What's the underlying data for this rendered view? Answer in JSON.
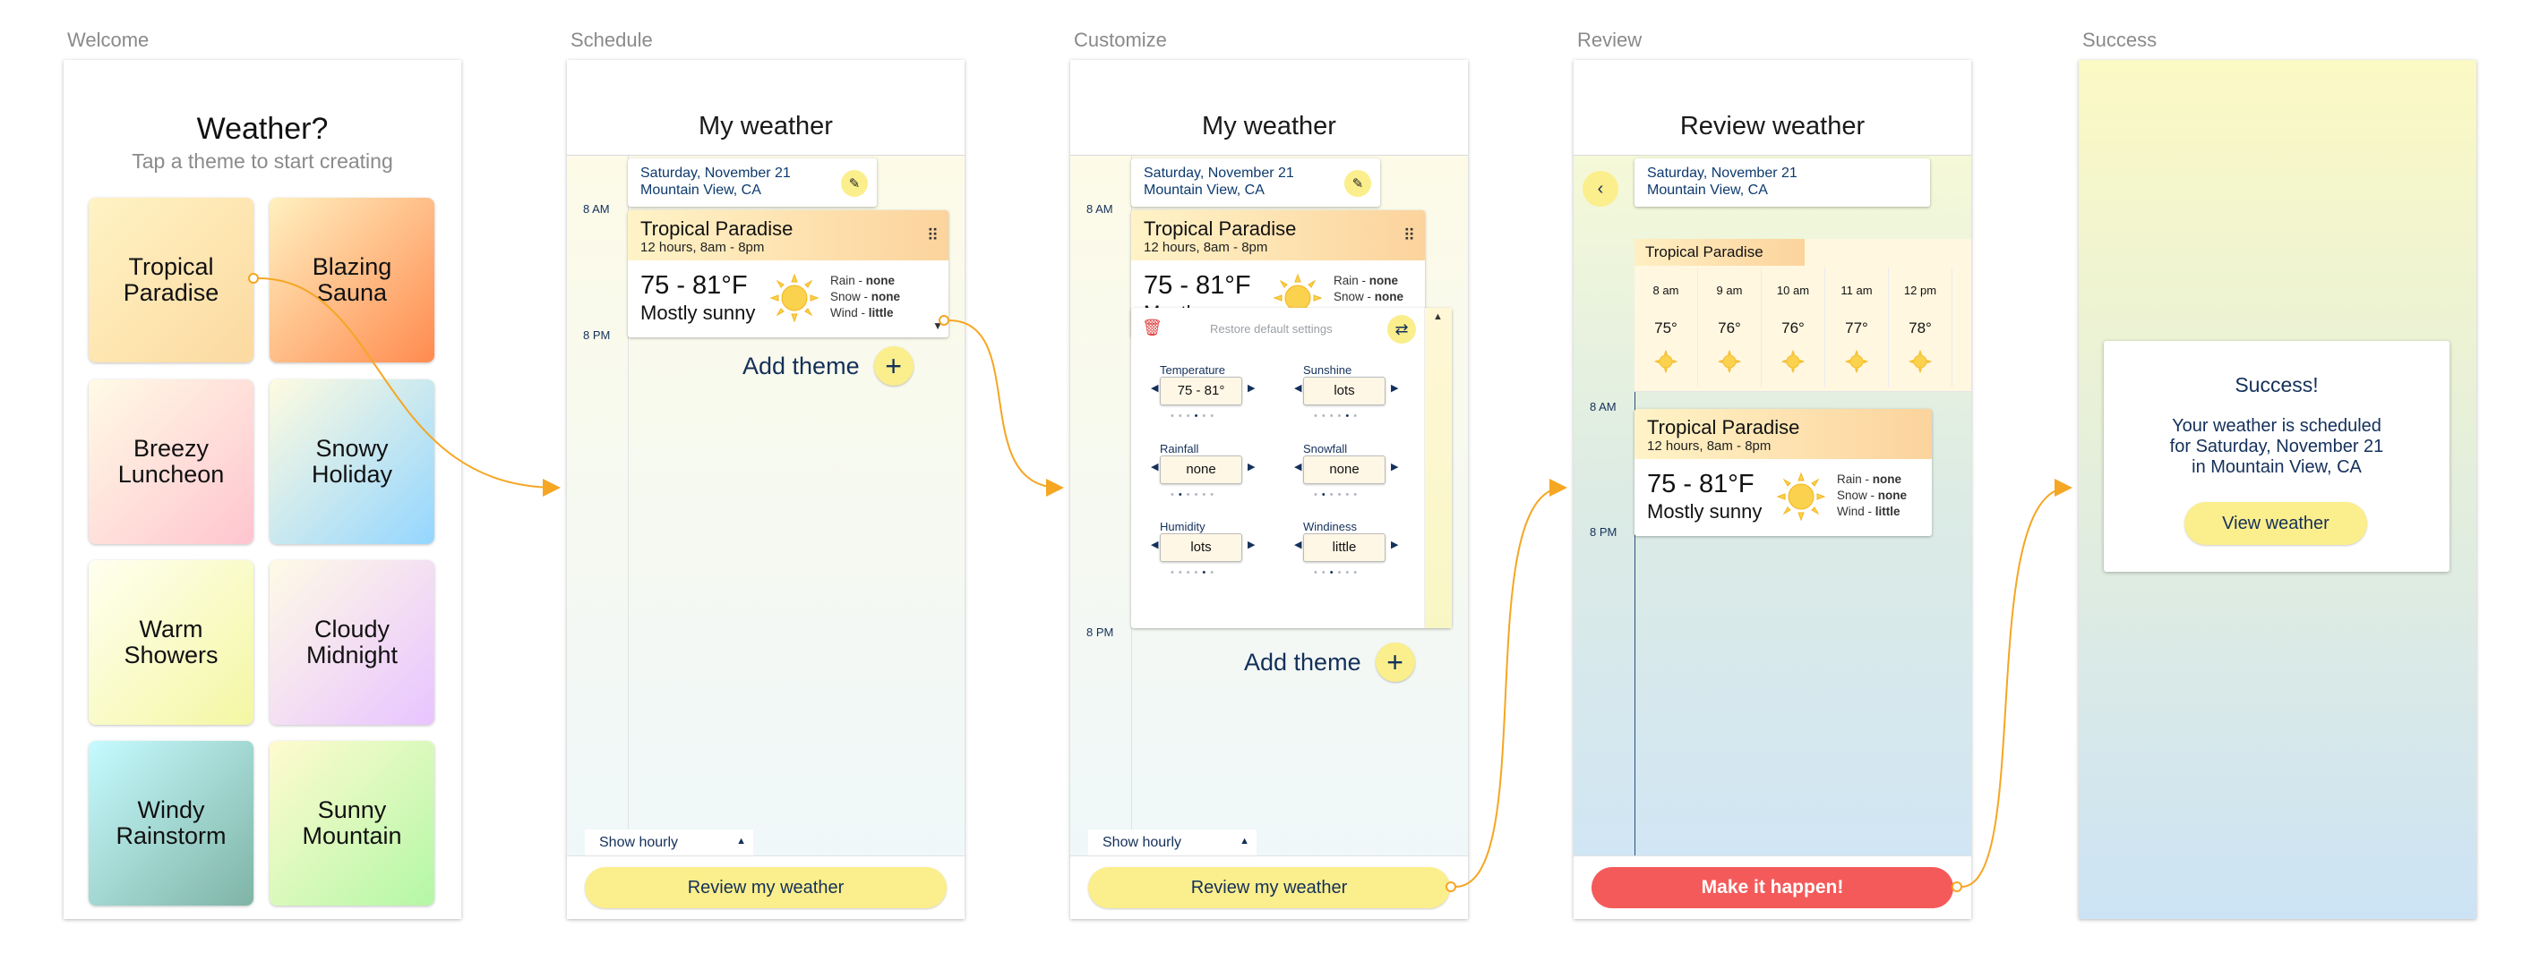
{
  "steps": [
    "Welcome",
    "Schedule",
    "Customize",
    "Review",
    "Success"
  ],
  "welcome": {
    "title": "Weather?",
    "subtitle": "Tap a theme to start creating",
    "themes": [
      {
        "line1": "Tropical",
        "line2": "Paradise"
      },
      {
        "line1": "Blazing",
        "line2": "Sauna"
      },
      {
        "line1": "Breezy",
        "line2": "Luncheon"
      },
      {
        "line1": "Snowy",
        "line2": "Holiday"
      },
      {
        "line1": "Warm",
        "line2": "Showers"
      },
      {
        "line1": "Cloudy",
        "line2": "Midnight"
      },
      {
        "line1": "Windy",
        "line2": "Rainstorm"
      },
      {
        "line1": "Sunny",
        "line2": "Mountain"
      }
    ]
  },
  "schedule": {
    "title": "My weather",
    "date": "Saturday, November 21",
    "location": "Mountain View, CA",
    "time_am": "8 AM",
    "time_pm": "8 PM",
    "theme": {
      "name": "Tropical Paradise",
      "hours": "12 hours,  8am - 8pm",
      "temp": "75 - 81°F",
      "condition": "Mostly sunny",
      "rain_label": "Rain - ",
      "rain_value": "none",
      "snow_label": "Snow - ",
      "snow_value": "none",
      "wind_label": "Wind - ",
      "wind_value": "little"
    },
    "add_theme": "Add theme",
    "show_hourly": "Show hourly",
    "review_button": "Review my weather"
  },
  "customize": {
    "title": "My weather",
    "restore": "Restore default settings",
    "settings": [
      {
        "name": "Temperature",
        "value": "75 - 81°"
      },
      {
        "name": "Sunshine",
        "value": "lots"
      },
      {
        "name": "Rainfall",
        "value": "none"
      },
      {
        "name": "Snowfall",
        "value": "none"
      },
      {
        "name": "Humidity",
        "value": "lots"
      },
      {
        "name": "Windiness",
        "value": "little"
      }
    ],
    "add_theme": "Add theme",
    "show_hourly": "Show hourly",
    "review_button": "Review my weather"
  },
  "review": {
    "title": "Review weather",
    "hourly_tag": "Tropical Paradise",
    "hours": [
      {
        "time": "8 am",
        "temp": "75°"
      },
      {
        "time": "9 am",
        "temp": "76°"
      },
      {
        "time": "10 am",
        "temp": "76°"
      },
      {
        "time": "11 am",
        "temp": "77°"
      },
      {
        "time": "12 pm",
        "temp": "78°"
      }
    ],
    "make_button": "Make it happen!"
  },
  "success": {
    "title": "Success!",
    "line1": "Your weather is scheduled",
    "line2": "for Saturday, November 21",
    "line3": "in Mountain View, CA",
    "button": "View weather"
  },
  "colors": {
    "accent": "#fbee8c",
    "primary_text": "#14305a",
    "alert": "#f45a5a",
    "flow_arrow": "#f5a623"
  },
  "icons": [
    "pencil-icon",
    "drag-grip-icon",
    "sun-icon",
    "plus-icon",
    "trash-icon",
    "swap-icon",
    "back-arrow-icon"
  ]
}
